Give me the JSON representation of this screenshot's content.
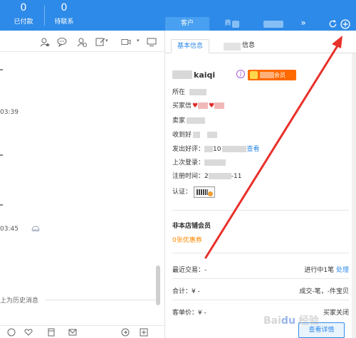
{
  "top_stats": [
    {
      "count": "0",
      "label": "已付款"
    },
    {
      "count": "0",
      "label": "待联系"
    }
  ],
  "tabs": {
    "customer": "客户",
    "second": "商",
    "more": "»"
  },
  "icons": {
    "refresh": "refresh-icon",
    "add": "add-circle-icon"
  },
  "chat": {
    "timestamps": [
      "03:39",
      "03:45"
    ],
    "history_label": "上为历史消息"
  },
  "info_tabs": {
    "basic": "基本信息",
    "other": "信息"
  },
  "customer": {
    "nickname": "kaiqi",
    "circle_badge": "J",
    "member_label": "会员",
    "fields": {
      "location": "所在",
      "buyer_credit": "买家信",
      "seller_credit": "卖家",
      "received_positive": "收到好",
      "sent_positive_prefix": "发出好评：",
      "sent_positive_value": "10",
      "sent_positive_link": "查看",
      "last_login": "上次登录：",
      "register_time_prefix": "注册时间：",
      "register_time_start": "2",
      "register_time_end": "-11",
      "verified": "认证："
    }
  },
  "store_member": {
    "title": "非本店铺会员",
    "coupon": "0张优惠券"
  },
  "stats": {
    "recent_trade_label": "最近交易：",
    "recent_trade_value": "-",
    "in_progress": "进行中1笔",
    "handle_link": "处理",
    "total_label": "合计：",
    "total_value": "¥ -",
    "deals": "成交-笔，-件宝贝",
    "avg_price_label": "客单价：",
    "avg_price_value": "¥ -",
    "closed": "买家关闭",
    "detail_button": "查看详情"
  },
  "annotation": {
    "arrow_color": "#e8302a"
  },
  "watermark": "Baidu 经验"
}
